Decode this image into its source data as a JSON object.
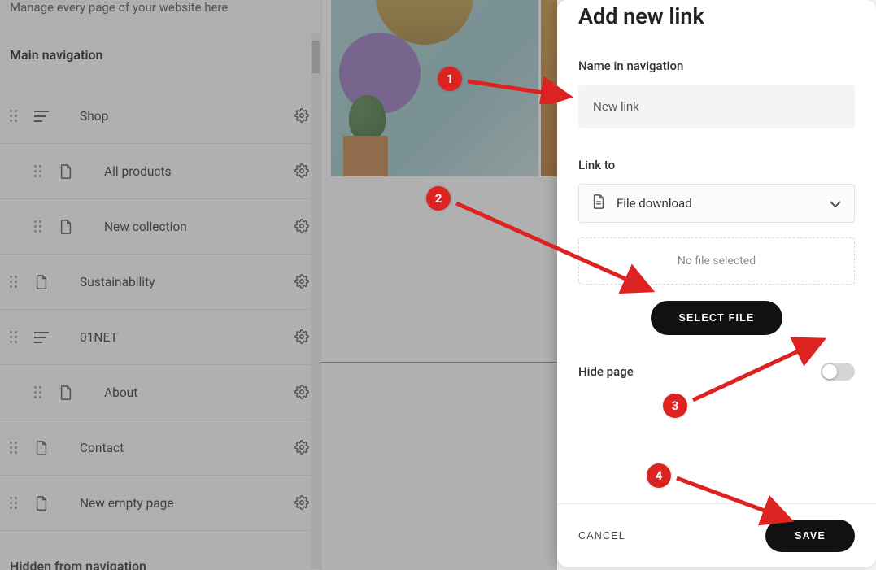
{
  "sidebar": {
    "subtitle": "Manage every page of your website here",
    "section_title": "Main navigation",
    "footer_section": "Hidden from navigation",
    "items": [
      {
        "label": "Shop",
        "icon": "menu",
        "child": false
      },
      {
        "label": "All products",
        "icon": "page",
        "child": true
      },
      {
        "label": "New collection",
        "icon": "page",
        "child": true
      },
      {
        "label": "Sustainability",
        "icon": "page",
        "child": false
      },
      {
        "label": "01NET",
        "icon": "menu",
        "child": false
      },
      {
        "label": "About",
        "icon": "page",
        "child": true
      },
      {
        "label": "Contact",
        "icon": "page",
        "child": false
      },
      {
        "label": "New empty page",
        "icon": "page",
        "child": false
      }
    ]
  },
  "panel": {
    "title": "Add new link",
    "name_field": {
      "label": "Name in navigation",
      "value": "New link"
    },
    "linkto_field": {
      "label": "Link to",
      "selected": "File download"
    },
    "dropzone_text": "No file selected",
    "select_file_label": "SELECT FILE",
    "hide_page_label": "Hide page",
    "hide_page_on": false,
    "cancel_label": "CANCEL",
    "save_label": "SAVE"
  },
  "annotations": {
    "badge1": "1",
    "badge2": "2",
    "badge3": "3",
    "badge4": "4"
  },
  "icons": {
    "page": "page-icon",
    "menu": "menu-lines-icon",
    "gear": "gear-icon",
    "drag": "drag-handle-icon",
    "chevron_down": "chevron-down-icon",
    "file_doc": "file-doc-icon"
  }
}
